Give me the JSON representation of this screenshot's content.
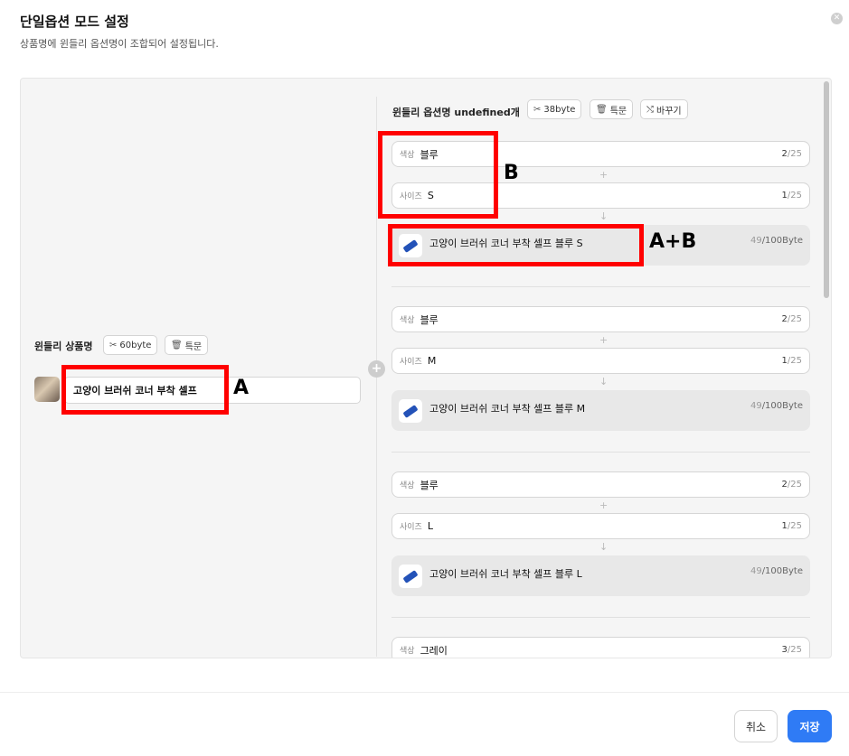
{
  "header": {
    "title": "단일옵션 모드 설정",
    "subtitle": "상품명에 윈들리 옵션명이 조합되어 설정됩니다.",
    "close_icon": "close-icon"
  },
  "left": {
    "label": "윈들리 상품명",
    "byte_chip": "60byte",
    "special_chip": "특문",
    "product_name": "고양이 브러쉬 코너 부착 셀프"
  },
  "right": {
    "label": "윈들리 옵션명 undefined개",
    "byte_chip": "38byte",
    "special_chip": "특문",
    "replace_chip": "바꾸기",
    "groups": [
      {
        "color_key": "색상",
        "color_val": "블루",
        "color_cnt": "2",
        "color_max": "/25",
        "size_key": "사이즈",
        "size_val": "S",
        "size_cnt": "1",
        "size_max": "/25",
        "result": "고양이 브러쉬 코너 부착 셀프 블루 S",
        "result_cnt": "49",
        "result_max": "/100Byte"
      },
      {
        "color_key": "색상",
        "color_val": "블루",
        "color_cnt": "2",
        "color_max": "/25",
        "size_key": "사이즈",
        "size_val": "M",
        "size_cnt": "1",
        "size_max": "/25",
        "result": "고양이 브러쉬 코너 부착 셀프 블루 M",
        "result_cnt": "49",
        "result_max": "/100Byte"
      },
      {
        "color_key": "색상",
        "color_val": "블루",
        "color_cnt": "2",
        "color_max": "/25",
        "size_key": "사이즈",
        "size_val": "L",
        "size_cnt": "1",
        "size_max": "/25",
        "result": "고양이 브러쉬 코너 부착 셀프 블루 L",
        "result_cnt": "49",
        "result_max": "/100Byte"
      },
      {
        "color_key": "색상",
        "color_val": "그레이",
        "color_cnt": "3",
        "color_max": "/25"
      }
    ],
    "plus_sign": "+",
    "arrow_sign": "↓"
  },
  "annotations": {
    "a": "A",
    "b": "B",
    "ab": "A+B",
    "color": "#ff0000"
  },
  "footer": {
    "cancel": "취소",
    "save": "저장"
  },
  "colors": {
    "primary": "#2f7bf5",
    "panel_bg": "#f5f5f5",
    "result_bg": "#e8e8e8"
  }
}
